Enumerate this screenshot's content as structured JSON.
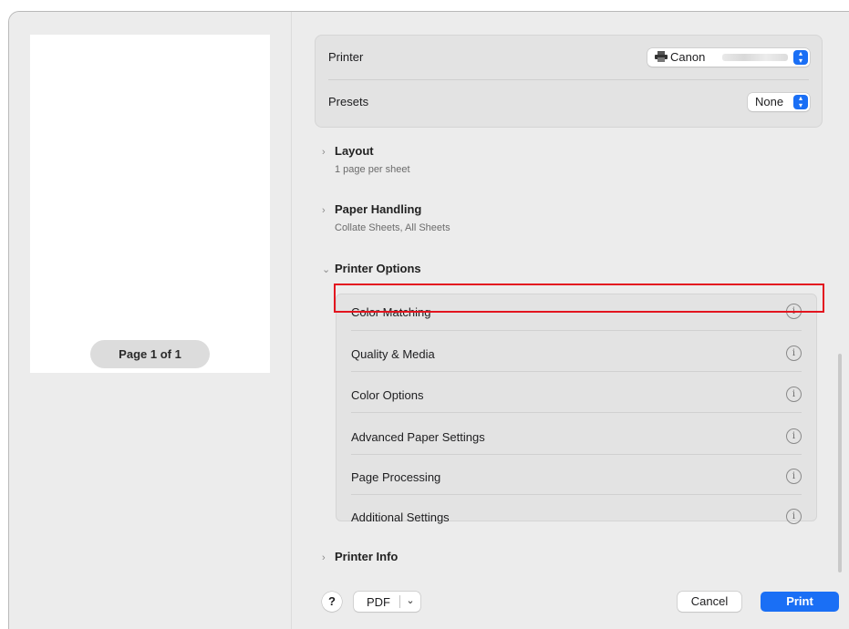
{
  "preview": {
    "page_indicator": "Page 1 of 1"
  },
  "printer": {
    "label": "Printer",
    "value": "Canon"
  },
  "presets": {
    "label": "Presets",
    "value": "None"
  },
  "sections": {
    "layout": {
      "title": "Layout",
      "summary": "1 page per sheet",
      "expanded": false
    },
    "paper_handling": {
      "title": "Paper Handling",
      "summary": "Collate Sheets, All Sheets",
      "expanded": false
    },
    "printer_options": {
      "title": "Printer Options",
      "expanded": true
    },
    "printer_info": {
      "title": "Printer Info",
      "expanded": false
    }
  },
  "printer_options": [
    {
      "label": "Color Matching",
      "highlighted": true
    },
    {
      "label": "Quality & Media"
    },
    {
      "label": "Color Options"
    },
    {
      "label": "Advanced Paper Settings"
    },
    {
      "label": "Page Processing"
    },
    {
      "label": "Additional Settings"
    }
  ],
  "icons": {
    "chevron_right": "›",
    "chevron_down": "⌄",
    "info": "i",
    "printer": "printer-icon",
    "stepper": "stepper-icon"
  },
  "footer": {
    "help": "?",
    "pdf": "PDF",
    "cancel": "Cancel",
    "print": "Print"
  },
  "colors": {
    "accent": "#1a6ff5",
    "highlight_border": "#e3151f",
    "panel": "#ececec"
  }
}
